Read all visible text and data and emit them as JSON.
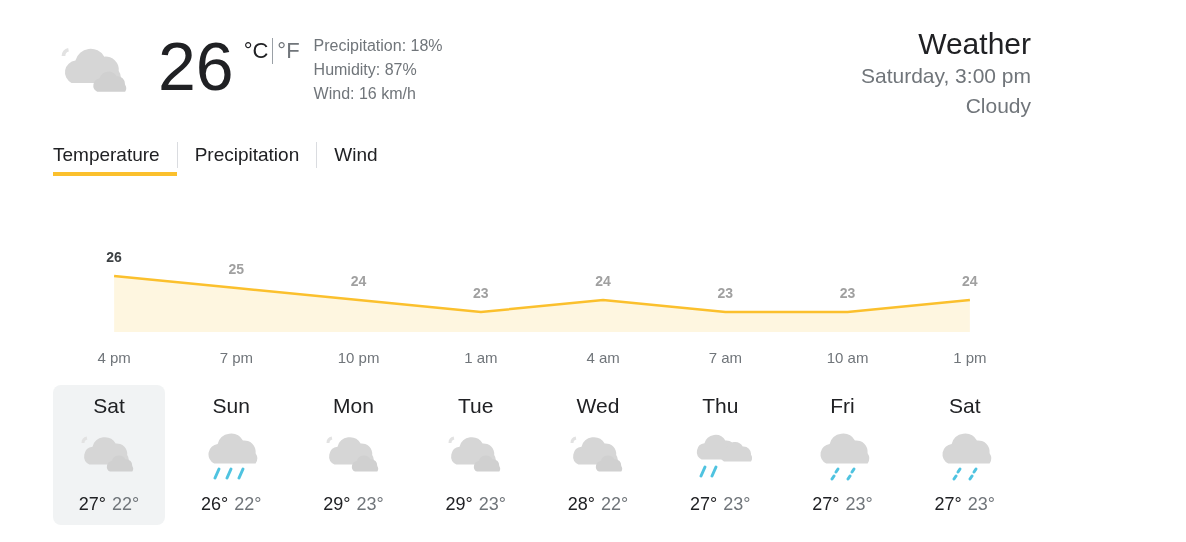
{
  "current": {
    "temperature": "26",
    "units": [
      {
        "label": "°C",
        "selected": true
      },
      {
        "label": "°F",
        "selected": false
      }
    ],
    "details": [
      "Precipitation: 18%",
      "Humidity: 87%",
      "Wind: 16 km/h"
    ]
  },
  "heading": {
    "title": "Weather",
    "time": "Saturday, 3:00 pm",
    "condition": "Cloudy"
  },
  "tabs": [
    {
      "label": "Temperature",
      "selected": true
    },
    {
      "label": "Precipitation",
      "selected": false
    },
    {
      "label": "Wind",
      "selected": false
    }
  ],
  "chart_data": {
    "type": "area",
    "categories": [
      "4 pm",
      "7 pm",
      "10 pm",
      "1 am",
      "4 am",
      "7 am",
      "10 am",
      "1 pm"
    ],
    "series": [
      {
        "color": "#fbc02d",
        "values": [
          26,
          25,
          24,
          23,
          24,
          23,
          23,
          24
        ]
      }
    ],
    "data_labels": true
  },
  "days": [
    {
      "name": "Sat",
      "kind": "cloudy",
      "high": "27°",
      "low": "22°",
      "selected": true
    },
    {
      "name": "Sun",
      "kind": "rain",
      "high": "26°",
      "low": "22°",
      "selected": false
    },
    {
      "name": "Mon",
      "kind": "cloudy",
      "high": "29°",
      "low": "23°",
      "selected": false
    },
    {
      "name": "Tue",
      "kind": "cloudy",
      "high": "29°",
      "low": "23°",
      "selected": false
    },
    {
      "name": "Wed",
      "kind": "cloudy",
      "high": "28°",
      "low": "22°",
      "selected": false
    },
    {
      "name": "Thu",
      "kind": "cloudy-rain",
      "high": "27°",
      "low": "23°",
      "selected": false
    },
    {
      "name": "Fri",
      "kind": "showers",
      "high": "27°",
      "low": "23°",
      "selected": false
    },
    {
      "name": "Sat",
      "kind": "showers",
      "high": "27°",
      "low": "23°",
      "selected": false
    }
  ]
}
